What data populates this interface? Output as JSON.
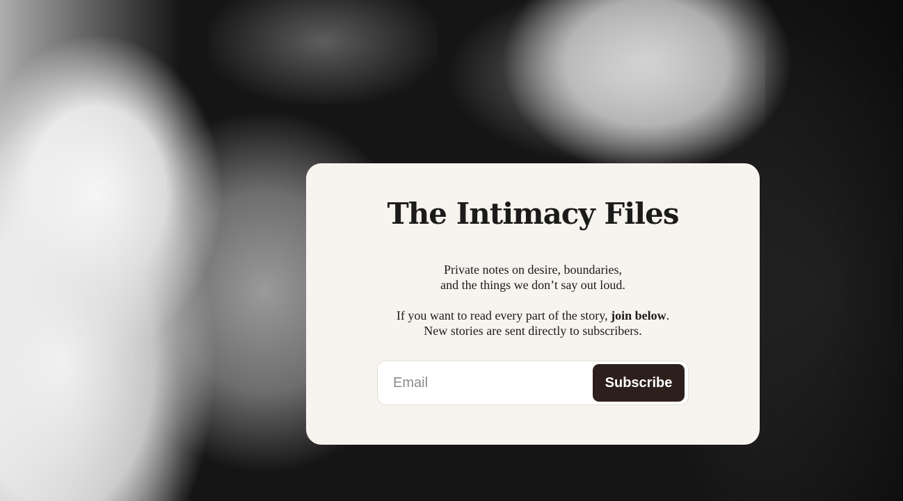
{
  "background": {
    "image_description": "black-and-white photo of a couple embracing",
    "card_color": "#f7f3ee",
    "button_color": "#2d1f1b"
  },
  "card": {
    "title": "The Intimacy Files",
    "description_line_1": "Private notes on desire, boundaries,",
    "description_line_2": "and the things we don’t say out loud.",
    "cta_prefix": "If you want to read every part of the story, ",
    "cta_bold": "join below",
    "cta_suffix": ".",
    "cta_line_2": "New stories are sent directly to subscribers."
  },
  "form": {
    "email_placeholder": "Email",
    "email_value": "",
    "subscribe_label": "Subscribe"
  }
}
